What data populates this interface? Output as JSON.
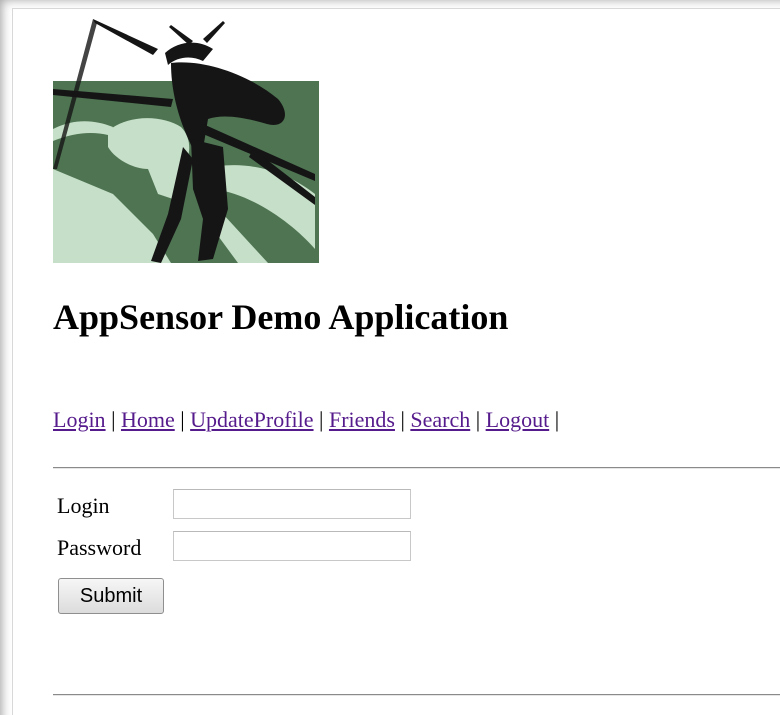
{
  "header": {
    "logo_icon": "praying-mantis-logo",
    "title": "AppSensor Demo Application"
  },
  "nav": {
    "items": [
      {
        "label": "Login"
      },
      {
        "label": "Home"
      },
      {
        "label": "UpdateProfile"
      },
      {
        "label": "Friends"
      },
      {
        "label": "Search"
      },
      {
        "label": "Logout"
      }
    ],
    "separator": "|"
  },
  "login_form": {
    "login_label": "Login",
    "login_value": "",
    "password_label": "Password",
    "password_value": "",
    "submit_label": "Submit"
  },
  "colors": {
    "link": "#551a8b",
    "logo_green": "#4e7452",
    "logo_light": "#c6dfc8",
    "logo_dark": "#151515"
  }
}
